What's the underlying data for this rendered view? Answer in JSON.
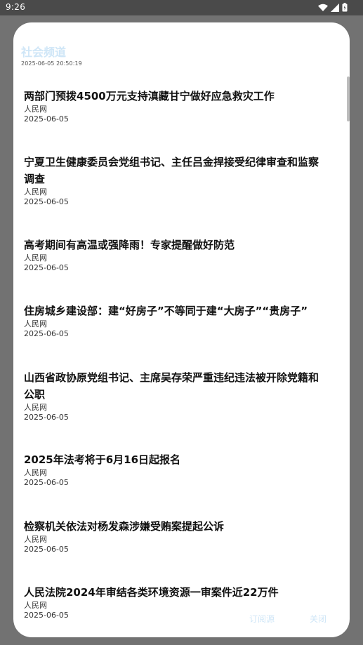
{
  "status_bar": {
    "time": "9:26"
  },
  "dialog": {
    "title": "社会频道",
    "timestamp": "2025-06-05 20:50:19",
    "actions": {
      "subscribe_label": "订阅源",
      "close_label": "关闭"
    }
  },
  "news": [
    {
      "title_lines": [
        "两部门预拨4500万元支持滇藏甘宁做好应急救灾工作"
      ],
      "source": "人民网",
      "date": "2025-06-05"
    },
    {
      "title_lines": [
        "宁夏卫生健康委员会党组书记、主任吕金捍接受纪律审查和监察",
        "调查"
      ],
      "source": "人民网",
      "date": "2025-06-05"
    },
    {
      "title_lines": [
        "高考期间有高温或强降雨！专家提醒做好防范"
      ],
      "source": "人民网",
      "date": "2025-06-05"
    },
    {
      "title_lines": [
        "住房城乡建设部：建“好房子”不等同于建“大房子”“贵房子”"
      ],
      "source": "人民网",
      "date": "2025-06-05"
    },
    {
      "title_lines": [
        "山西省政协原党组书记、主席吴存荣严重违纪违法被开除党籍和",
        "公职"
      ],
      "source": "人民网",
      "date": "2025-06-05"
    },
    {
      "title_lines": [
        "2025年法考将于6月16日起报名"
      ],
      "source": "人民网",
      "date": "2025-06-05"
    },
    {
      "title_lines": [
        "检察机关依法对杨发森涉嫌受贿案提起公诉"
      ],
      "source": "人民网",
      "date": "2025-06-05"
    },
    {
      "title_lines": [
        "人民法院2024年审结各类环境资源一审案件近22万件"
      ],
      "source": "人民网",
      "date": "2025-06-05"
    }
  ]
}
